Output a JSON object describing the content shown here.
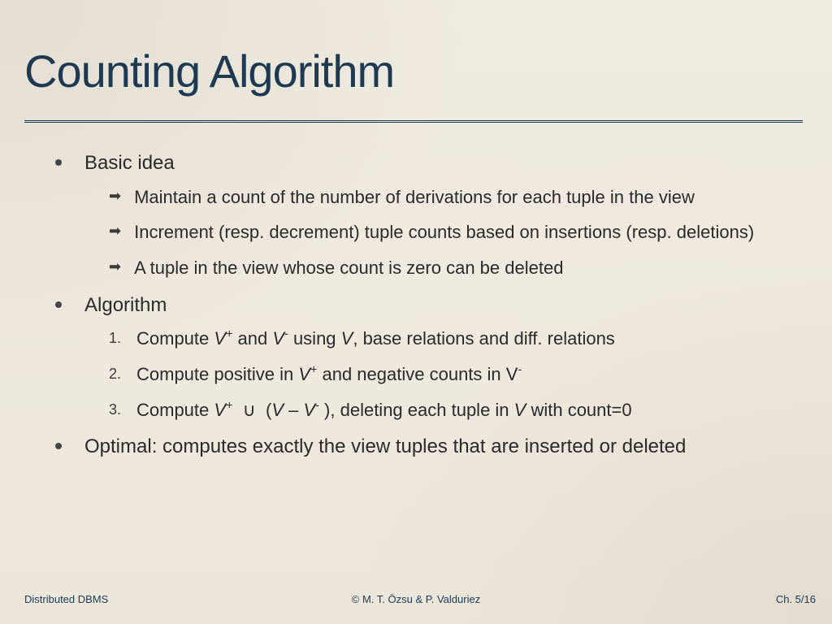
{
  "title": "Counting Algorithm",
  "bullets": [
    {
      "label": "Basic idea",
      "kind": "arrow",
      "items": [
        "Maintain a count of the number of derivations for each tuple in the view",
        "Increment (resp. decrement) tuple counts based on insertions (resp. deletions)",
        "A tuple in the view whose count is zero can be deleted"
      ]
    },
    {
      "label": "Algorithm",
      "kind": "num",
      "items_html": [
        "Compute <span class='ital'>V</span><sup>+</sup> and <span class='ital'>V</span><sup>-</sup> using <span class='ital'>V</span>, base relations and diff. relations",
        "Compute positive in <span class='ital'>V</span><sup>+</sup> and negative counts in V<sup>-</sup>",
        "Compute <span class='ital'>V</span><sup>+</sup> &nbsp;&cup;&nbsp; (<span class='ital'>V</span> – <span class='ital'>V</span><sup>-</sup> ), deleting each tuple in <span class='ital'>V</span> with count=0"
      ]
    },
    {
      "label": "Optimal: computes exactly the view tuples that are inserted or deleted",
      "kind": "none"
    }
  ],
  "footer": {
    "left": "Distributed DBMS",
    "center": "© M. T. Özsu & P. Valduriez",
    "right": "Ch. 5/16"
  }
}
